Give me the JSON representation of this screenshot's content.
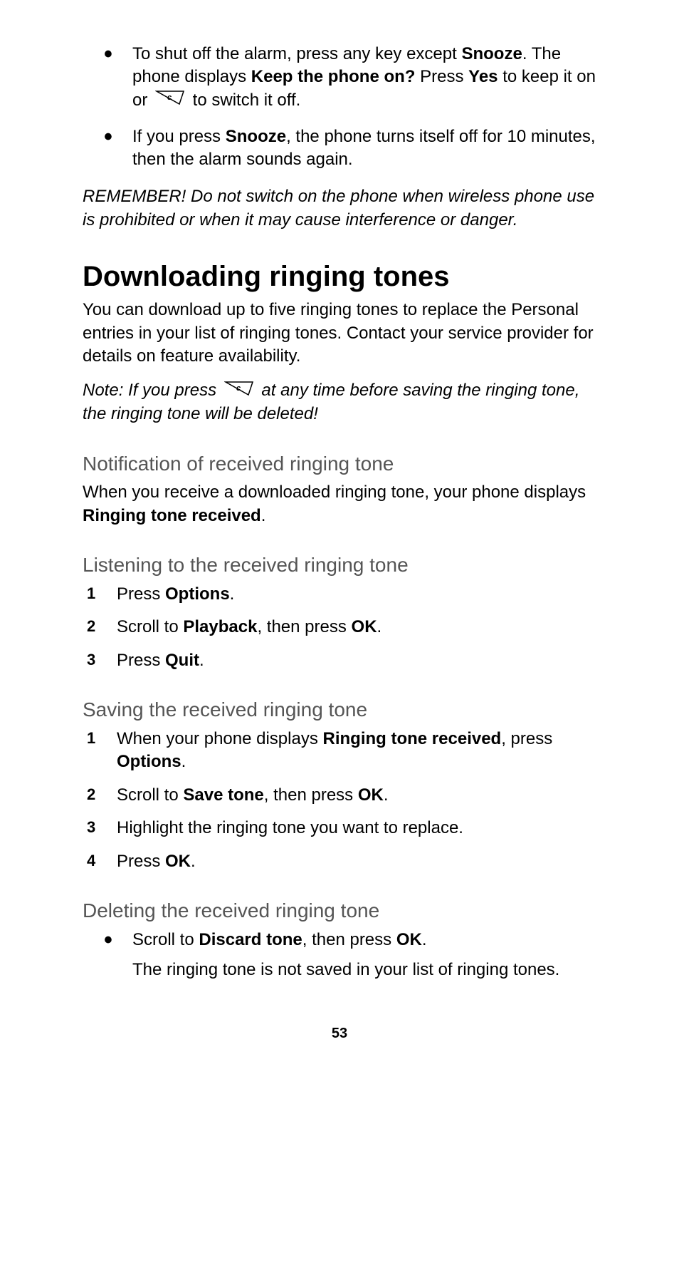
{
  "alarm": {
    "bullet1_a": "To shut off the alarm, press any key except ",
    "bullet1_snooze": "Snooze",
    "bullet1_b": ". The phone displays ",
    "bullet1_keep": "Keep the phone on?",
    "bullet1_c": " Press ",
    "bullet1_yes": "Yes",
    "bullet1_d": " to keep it on or ",
    "bullet1_e": " to switch it off.",
    "bullet2_a": "If you press ",
    "bullet2_snooze": "Snooze",
    "bullet2_b": ", the phone turns itself off for 10 minutes, then the alarm sounds again."
  },
  "remember": "REMEMBER! Do not switch on the phone when wireless phone use is prohibited or when it may cause interference or danger.",
  "downloading": {
    "title": "Downloading ringing tones",
    "intro": "You can download up to five ringing tones to replace the Personal entries in your list of ringing tones. Contact your service provider for details on feature availability.",
    "note_a": "Note: If you press ",
    "note_b": " at any time before saving the ringing tone, the ringing tone will be deleted!"
  },
  "notification": {
    "title": "Notification of received ringing tone",
    "text_a": "When you receive a downloaded ringing tone, your phone displays ",
    "text_b": "Ringing tone received",
    "text_c": "."
  },
  "listening": {
    "title": "Listening to the received ringing tone",
    "step1_a": "Press ",
    "step1_b": "Options",
    "step1_c": ".",
    "step2_a": "Scroll to ",
    "step2_b": "Playback",
    "step2_c": ", then press ",
    "step2_d": "OK",
    "step2_e": ".",
    "step3_a": "Press ",
    "step3_b": "Quit",
    "step3_c": "."
  },
  "saving": {
    "title": "Saving the received ringing tone",
    "step1_a": "When your phone displays ",
    "step1_b": "Ringing tone received",
    "step1_c": ", press ",
    "step1_d": "Options",
    "step1_e": ".",
    "step2_a": "Scroll to ",
    "step2_b": "Save tone",
    "step2_c": ", then press ",
    "step2_d": "OK",
    "step2_e": ".",
    "step3": "Highlight the ringing tone you want to replace.",
    "step4_a": "Press ",
    "step4_b": "OK",
    "step4_c": "."
  },
  "deleting": {
    "title": "Deleting the received ringing tone",
    "bullet_a": "Scroll to ",
    "bullet_b": "Discard tone",
    "bullet_c": ", then press ",
    "bullet_d": "OK",
    "bullet_e": ".",
    "sub": "The ringing tone is not saved in your list of ringing tones."
  },
  "page": "53"
}
